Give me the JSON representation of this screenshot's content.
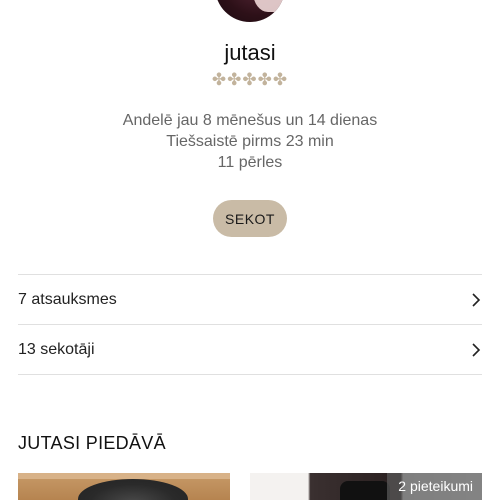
{
  "profile": {
    "username": "jutasi",
    "rating_stars": "✤✤✤✤✤",
    "member_since": "Andelē jau 8 mēnešus un 14 dienas",
    "last_online": "Tiešsaistē pirms 23 min",
    "pearls": "11 pērles"
  },
  "actions": {
    "follow_label": "SEKOT"
  },
  "links": [
    {
      "label": "7 atsauksmes"
    },
    {
      "label": "13 sekotāji"
    }
  ],
  "offers": {
    "title": "JUTASI PIEDĀVĀ",
    "items": [
      {
        "badge": ""
      },
      {
        "badge": "2 pieteikumi"
      }
    ]
  },
  "colors": {
    "accent_button": "#c9bba6",
    "stars": "#c2b39c",
    "divider": "#e0e0e0"
  },
  "icons": [
    "chevron-right-icon"
  ]
}
